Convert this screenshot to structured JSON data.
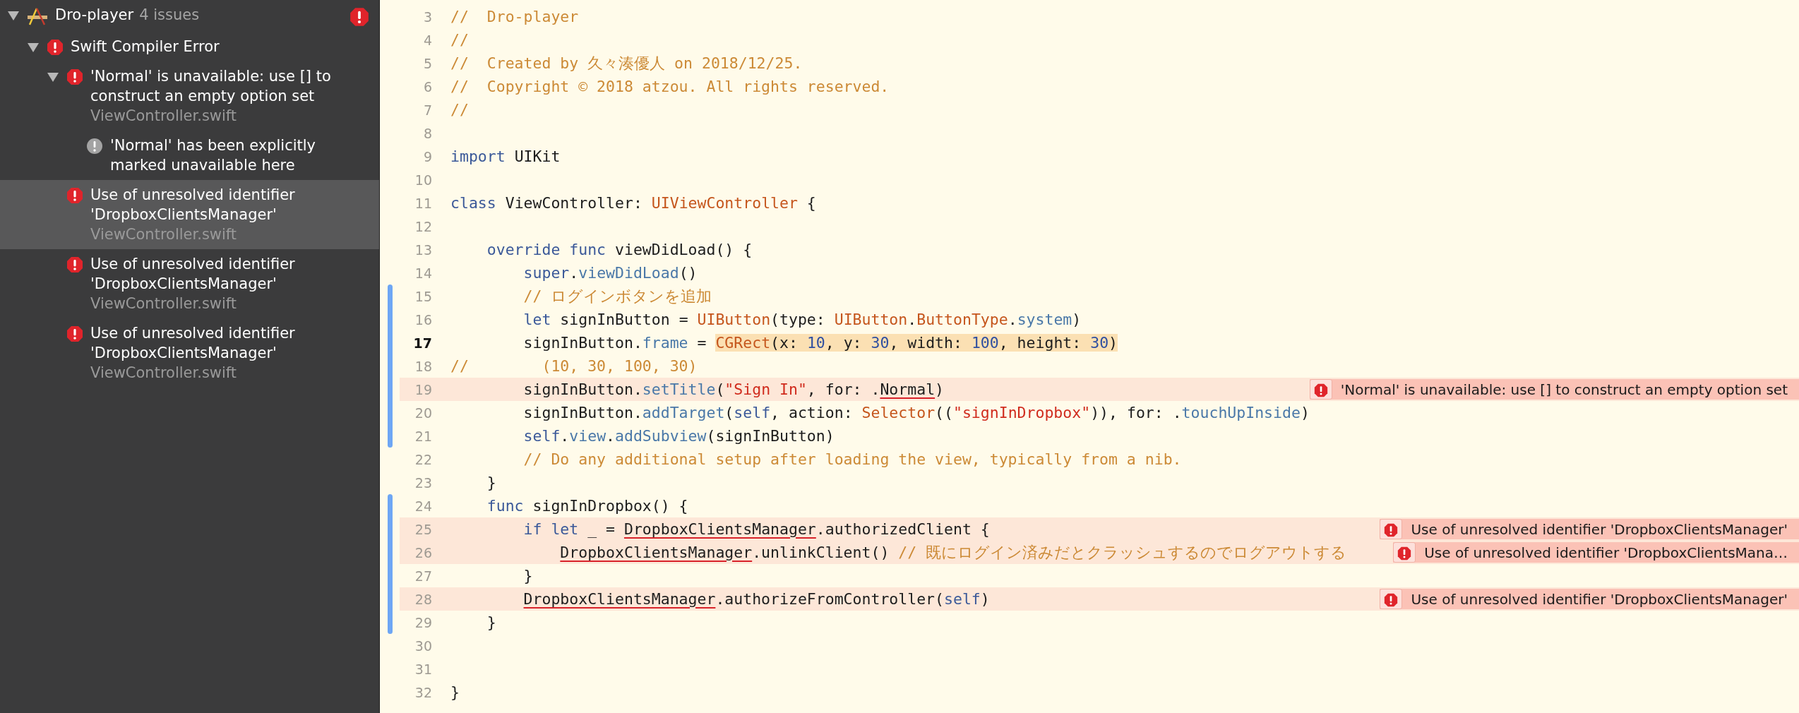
{
  "issue_navigator": {
    "project": {
      "title": "Dro-player",
      "count": "4 issues",
      "expanded": true,
      "selected": false,
      "children": [
        {
          "kind": "group",
          "title": "Swift Compiler Error",
          "expanded": true,
          "selected": false,
          "children": [
            {
              "kind": "error",
              "message": "'Normal' is unavailable: use [] to construct an empty option set",
              "file": "ViewController.swift",
              "expanded": true,
              "selected": false,
              "children": [
                {
                  "kind": "note",
                  "message": "'Normal' has been explicitly marked unavailable here",
                  "selected": false
                }
              ]
            },
            {
              "kind": "error",
              "message": "Use of unresolved identifier 'DropboxClientsManager'",
              "file": "ViewController.swift",
              "selected": true
            },
            {
              "kind": "error",
              "message": "Use of unresolved identifier 'DropboxClientsManager'",
              "file": "ViewController.swift",
              "selected": false
            },
            {
              "kind": "error",
              "message": "Use of unresolved identifier 'DropboxClientsManager'",
              "file": "ViewController.swift",
              "selected": false
            }
          ]
        }
      ]
    }
  },
  "editor": {
    "lines": [
      {
        "number": "3",
        "changed": false,
        "error": false,
        "current": false,
        "tokens": [
          {
            "kind": "comment",
            "text": "//  Dro-player"
          }
        ]
      },
      {
        "number": "4",
        "changed": false,
        "error": false,
        "current": false,
        "tokens": [
          {
            "kind": "comment",
            "text": "//"
          }
        ]
      },
      {
        "number": "5",
        "changed": false,
        "error": false,
        "current": false,
        "tokens": [
          {
            "kind": "comment",
            "text": "//  Created by 久々湊優人 on 2018/12/25."
          }
        ]
      },
      {
        "number": "6",
        "changed": false,
        "error": false,
        "current": false,
        "tokens": [
          {
            "kind": "comment",
            "text": "//  Copyright © 2018 atzou. All rights reserved."
          }
        ]
      },
      {
        "number": "7",
        "changed": false,
        "error": false,
        "current": false,
        "tokens": [
          {
            "kind": "comment",
            "text": "//"
          }
        ]
      },
      {
        "number": "8",
        "changed": false,
        "error": false,
        "current": false
      },
      {
        "number": "9",
        "changed": false,
        "error": false,
        "current": false,
        "tokens": [
          {
            "kind": "keyword",
            "text": "import"
          },
          {
            "kind": "plain",
            "text": " UIKit"
          }
        ]
      },
      {
        "number": "10",
        "changed": false,
        "error": false,
        "current": false
      },
      {
        "number": "11",
        "changed": false,
        "error": false,
        "current": false,
        "tokens": [
          {
            "kind": "keyword",
            "text": "class"
          },
          {
            "kind": "plain",
            "text": " ViewController: "
          },
          {
            "kind": "type",
            "text": "UIViewController"
          },
          {
            "kind": "plain",
            "text": " {"
          }
        ]
      },
      {
        "number": "12",
        "changed": false,
        "error": false,
        "current": false
      },
      {
        "number": "13",
        "changed": false,
        "error": false,
        "current": false,
        "tokens": [
          {
            "kind": "keyword",
            "text": "    override "
          },
          {
            "kind": "keyword",
            "text": "func"
          },
          {
            "kind": "plain",
            "text": " viewDidLoad() {"
          }
        ]
      },
      {
        "number": "14",
        "changed": false,
        "error": false,
        "current": false,
        "tokens": [
          {
            "kind": "keyword",
            "text": "        super"
          },
          {
            "kind": "plain",
            "text": "."
          },
          {
            "kind": "member",
            "text": "viewDidLoad"
          },
          {
            "kind": "plain",
            "text": "()"
          }
        ]
      },
      {
        "number": "15",
        "changed": true,
        "error": false,
        "current": false,
        "tokens": [
          {
            "kind": "comment",
            "text": "        // ログインボタンを追加"
          }
        ]
      },
      {
        "number": "16",
        "changed": true,
        "error": false,
        "current": false,
        "tokens": [
          {
            "kind": "keyword",
            "text": "        let"
          },
          {
            "kind": "plain",
            "text": " signInButton = "
          },
          {
            "kind": "type",
            "text": "UIButton"
          },
          {
            "kind": "plain",
            "text": "(type: "
          },
          {
            "kind": "type",
            "text": "UIButton"
          },
          {
            "kind": "plain",
            "text": "."
          },
          {
            "kind": "type",
            "text": "ButtonType"
          },
          {
            "kind": "plain",
            "text": "."
          },
          {
            "kind": "member",
            "text": "system"
          },
          {
            "kind": "plain",
            "text": ")"
          }
        ]
      },
      {
        "number": "17",
        "changed": true,
        "error": false,
        "current": true,
        "tokens": [
          {
            "kind": "plain",
            "text": "        signInButton.",
            "highlighted": false
          },
          {
            "kind": "member",
            "text": "frame",
            "highlighted": false
          },
          {
            "kind": "plain",
            "text": " = ",
            "highlighted": false
          },
          {
            "kind": "type",
            "text": "CGRect",
            "highlighted": true
          },
          {
            "kind": "plain",
            "text": "(x: ",
            "highlighted": true
          },
          {
            "kind": "number",
            "text": "10",
            "highlighted": true
          },
          {
            "kind": "plain",
            "text": ", y: ",
            "highlighted": true
          },
          {
            "kind": "number",
            "text": "30",
            "highlighted": true
          },
          {
            "kind": "plain",
            "text": ", width: ",
            "highlighted": true
          },
          {
            "kind": "number",
            "text": "100",
            "highlighted": true
          },
          {
            "kind": "plain",
            "text": ", height: ",
            "highlighted": true
          },
          {
            "kind": "number",
            "text": "30",
            "highlighted": true
          },
          {
            "kind": "plain",
            "text": ")",
            "highlighted": true
          }
        ]
      },
      {
        "number": "18",
        "changed": true,
        "error": false,
        "current": false,
        "tokens": [
          {
            "kind": "comment",
            "text": "//        (10, 30, 100, 30)"
          }
        ]
      },
      {
        "number": "19",
        "changed": true,
        "error": true,
        "current": false,
        "tokens": [
          {
            "kind": "plain",
            "text": "        signInButton."
          },
          {
            "kind": "member",
            "text": "setTitle"
          },
          {
            "kind": "plain",
            "text": "("
          },
          {
            "kind": "string",
            "text": "\"Sign In\""
          },
          {
            "kind": "plain",
            "text": ", for: ."
          },
          {
            "kind": "unresolved",
            "text": "Normal"
          },
          {
            "kind": "plain",
            "text": ")"
          }
        ],
        "annotation": "'Normal' is unavailable: use [] to construct an empty option set"
      },
      {
        "number": "20",
        "changed": true,
        "error": false,
        "current": false,
        "tokens": [
          {
            "kind": "plain",
            "text": "        signInButton."
          },
          {
            "kind": "member",
            "text": "addTarget"
          },
          {
            "kind": "plain",
            "text": "("
          },
          {
            "kind": "keyword",
            "text": "self"
          },
          {
            "kind": "plain",
            "text": ", action: "
          },
          {
            "kind": "type",
            "text": "Selector"
          },
          {
            "kind": "plain",
            "text": "(("
          },
          {
            "kind": "string",
            "text": "\"signInDropbox\""
          },
          {
            "kind": "plain",
            "text": ")), for: ."
          },
          {
            "kind": "member",
            "text": "touchUpInside"
          },
          {
            "kind": "plain",
            "text": ")"
          }
        ]
      },
      {
        "number": "21",
        "changed": true,
        "error": false,
        "current": false,
        "tokens": [
          {
            "kind": "keyword",
            "text": "        self"
          },
          {
            "kind": "plain",
            "text": "."
          },
          {
            "kind": "member",
            "text": "view"
          },
          {
            "kind": "plain",
            "text": "."
          },
          {
            "kind": "member",
            "text": "addSubview"
          },
          {
            "kind": "plain",
            "text": "(signInButton)"
          }
        ]
      },
      {
        "number": "22",
        "changed": false,
        "error": false,
        "current": false,
        "tokens": [
          {
            "kind": "comment",
            "text": "        // Do any additional setup after loading the view, typically from a nib."
          }
        ]
      },
      {
        "number": "23",
        "changed": false,
        "error": false,
        "current": false,
        "tokens": [
          {
            "kind": "plain",
            "text": "    }"
          }
        ]
      },
      {
        "number": "24",
        "changed": true,
        "error": false,
        "current": false,
        "tokens": [
          {
            "kind": "keyword",
            "text": "    func"
          },
          {
            "kind": "plain",
            "text": " signInDropbox() {"
          }
        ]
      },
      {
        "number": "25",
        "changed": true,
        "error": true,
        "current": false,
        "tokens": [
          {
            "kind": "keyword",
            "text": "        if let"
          },
          {
            "kind": "plain",
            "text": " _ = "
          },
          {
            "kind": "unresolved",
            "text": "DropboxClientsManager"
          },
          {
            "kind": "plain",
            "text": ".authorizedClient {"
          }
        ],
        "annotation": "Use of unresolved identifier 'DropboxClientsManager'"
      },
      {
        "number": "26",
        "changed": true,
        "error": true,
        "current": false,
        "tokens": [
          {
            "kind": "unresolved",
            "text": "            DropboxClientsManager"
          },
          {
            "kind": "plain",
            "text": ".unlinkClient() "
          },
          {
            "kind": "comment",
            "text": "// 既にログイン済みだとクラッシュするのでログアウトする"
          }
        ],
        "annotation": "Use of unresolved identifier 'DropboxClientsMana…"
      },
      {
        "number": "27",
        "changed": true,
        "error": false,
        "current": false,
        "tokens": [
          {
            "kind": "plain",
            "text": "        }"
          }
        ]
      },
      {
        "number": "28",
        "changed": true,
        "error": true,
        "current": false,
        "tokens": [
          {
            "kind": "unresolved",
            "text": "        DropboxClientsManager"
          },
          {
            "kind": "plain",
            "text": ".authorizeFromController("
          },
          {
            "kind": "keyword",
            "text": "self"
          },
          {
            "kind": "plain",
            "text": ")"
          }
        ],
        "annotation": "Use of unresolved identifier 'DropboxClientsManager'"
      },
      {
        "number": "29",
        "changed": true,
        "error": false,
        "current": false,
        "tokens": [
          {
            "kind": "plain",
            "text": "    }"
          }
        ]
      },
      {
        "number": "30",
        "changed": false,
        "error": false,
        "current": false
      },
      {
        "number": "31",
        "changed": false,
        "error": false,
        "current": false
      },
      {
        "number": "32",
        "changed": false,
        "error": false,
        "current": false,
        "tokens": [
          {
            "kind": "plain",
            "text": "}"
          }
        ]
      }
    ]
  }
}
